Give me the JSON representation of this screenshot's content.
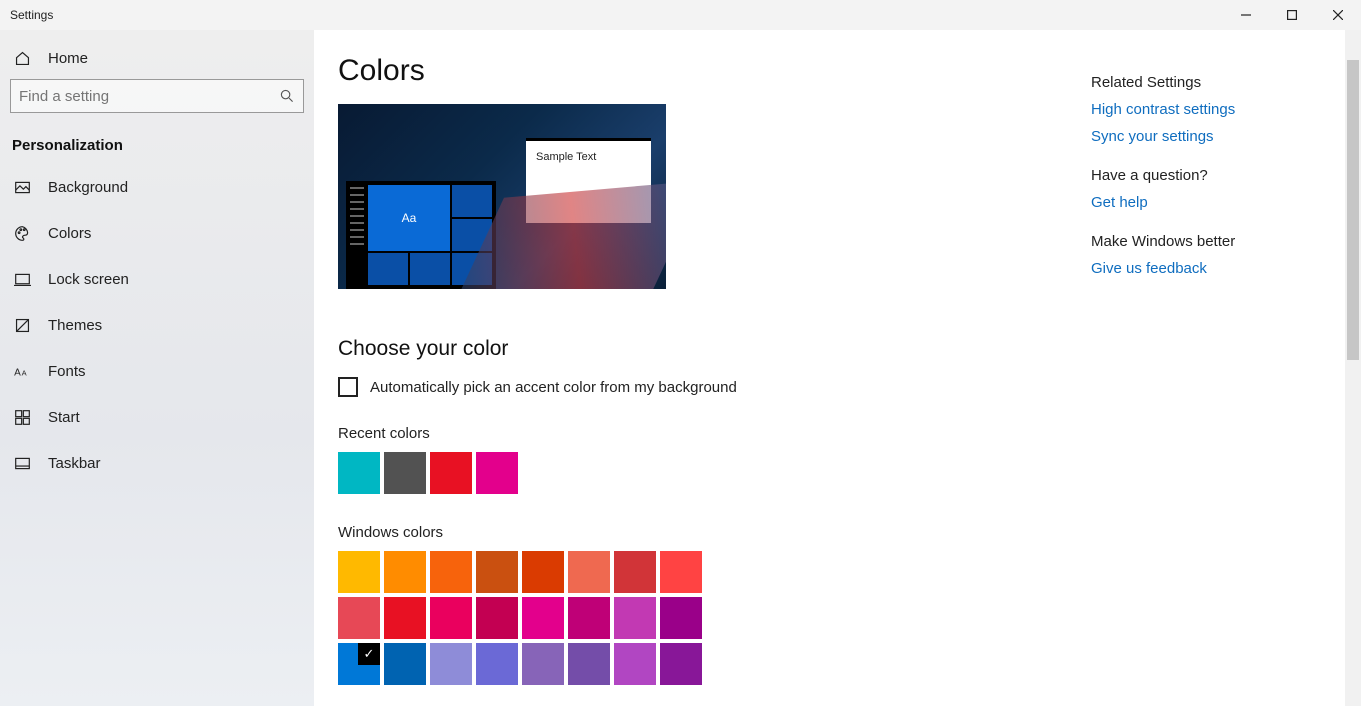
{
  "window_title": "Settings",
  "home_label": "Home",
  "search_placeholder": "Find a setting",
  "category_label": "Personalization",
  "nav_items": [
    {
      "key": "background",
      "label": "Background"
    },
    {
      "key": "colors",
      "label": "Colors"
    },
    {
      "key": "lockscreen",
      "label": "Lock screen"
    },
    {
      "key": "themes",
      "label": "Themes"
    },
    {
      "key": "fonts",
      "label": "Fonts"
    },
    {
      "key": "start",
      "label": "Start"
    },
    {
      "key": "taskbar",
      "label": "Taskbar"
    }
  ],
  "page_title": "Colors",
  "preview_tile_text": "Aa",
  "preview_sample_text": "Sample Text",
  "choose_color_heading": "Choose your color",
  "auto_pick_checkbox_label": "Automatically pick an accent color from my background",
  "auto_pick_checked": false,
  "recent_colors_label": "Recent colors",
  "recent_colors": [
    "#00b7c3",
    "#525252",
    "#e81123",
    "#e3008c"
  ],
  "windows_colors_label": "Windows colors",
  "windows_colors": [
    "#ffb900",
    "#ff8c00",
    "#f7630c",
    "#ca5010",
    "#da3b01",
    "#ef6950",
    "#d13438",
    "#ff4343",
    "#e74856",
    "#e81123",
    "#ea005e",
    "#c30052",
    "#e3008c",
    "#bf0077",
    "#c239b3",
    "#9a0089",
    "#0078d7",
    "#0063b1",
    "#8e8cd8",
    "#6b69d6",
    "#8764b8",
    "#744da9",
    "#b146c2",
    "#881798"
  ],
  "selected_windows_color_index": 16,
  "rail": {
    "related_heading": "Related Settings",
    "related_links": [
      "High contrast settings",
      "Sync your settings"
    ],
    "question_heading": "Have a question?",
    "question_link": "Get help",
    "improve_heading": "Make Windows better",
    "improve_link": "Give us feedback"
  }
}
